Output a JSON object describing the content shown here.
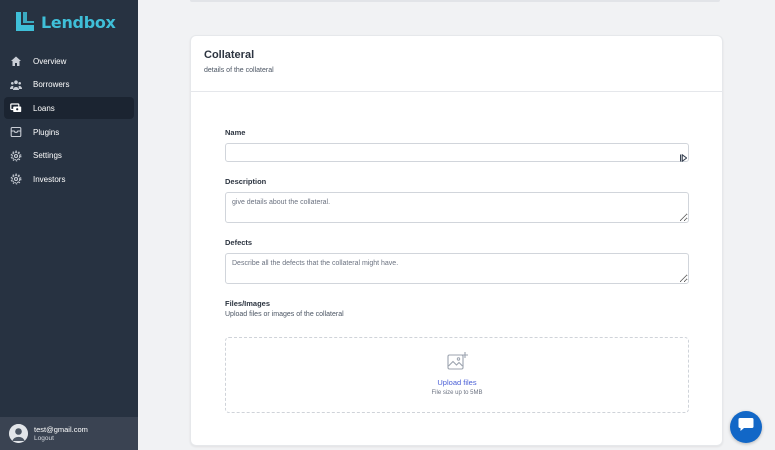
{
  "brand": {
    "name": "Lendbox",
    "color": "#3fbfd8"
  },
  "sidebar": {
    "items": [
      {
        "label": "Overview",
        "icon": "home-icon",
        "active": false
      },
      {
        "label": "Borrowers",
        "icon": "users-icon",
        "active": false
      },
      {
        "label": "Loans",
        "icon": "cash-icon",
        "active": true
      },
      {
        "label": "Plugins",
        "icon": "box-icon",
        "active": false
      },
      {
        "label": "Settings",
        "icon": "gear-icon",
        "active": false
      },
      {
        "label": "Investors",
        "icon": "cog-icon",
        "active": false
      }
    ]
  },
  "user": {
    "email": "test@gmail.com",
    "logout_label": "Logout"
  },
  "card": {
    "title": "Collateral",
    "subtitle": "details of the collateral"
  },
  "form": {
    "name": {
      "label": "Name",
      "value": ""
    },
    "description": {
      "label": "Description",
      "placeholder": "give details about the collateral."
    },
    "defects": {
      "label": "Defects",
      "placeholder": "Describe all the defects that the collateral might have."
    },
    "files": {
      "label": "Files/Images",
      "subtitle": "Upload files or images of the collateral",
      "upload_link": "Upload files",
      "hint": "File size up to 5MB"
    }
  },
  "colors": {
    "sidebar_bg": "#273241",
    "accent_link": "#4a5fd6",
    "chat_button": "#1267c7"
  }
}
